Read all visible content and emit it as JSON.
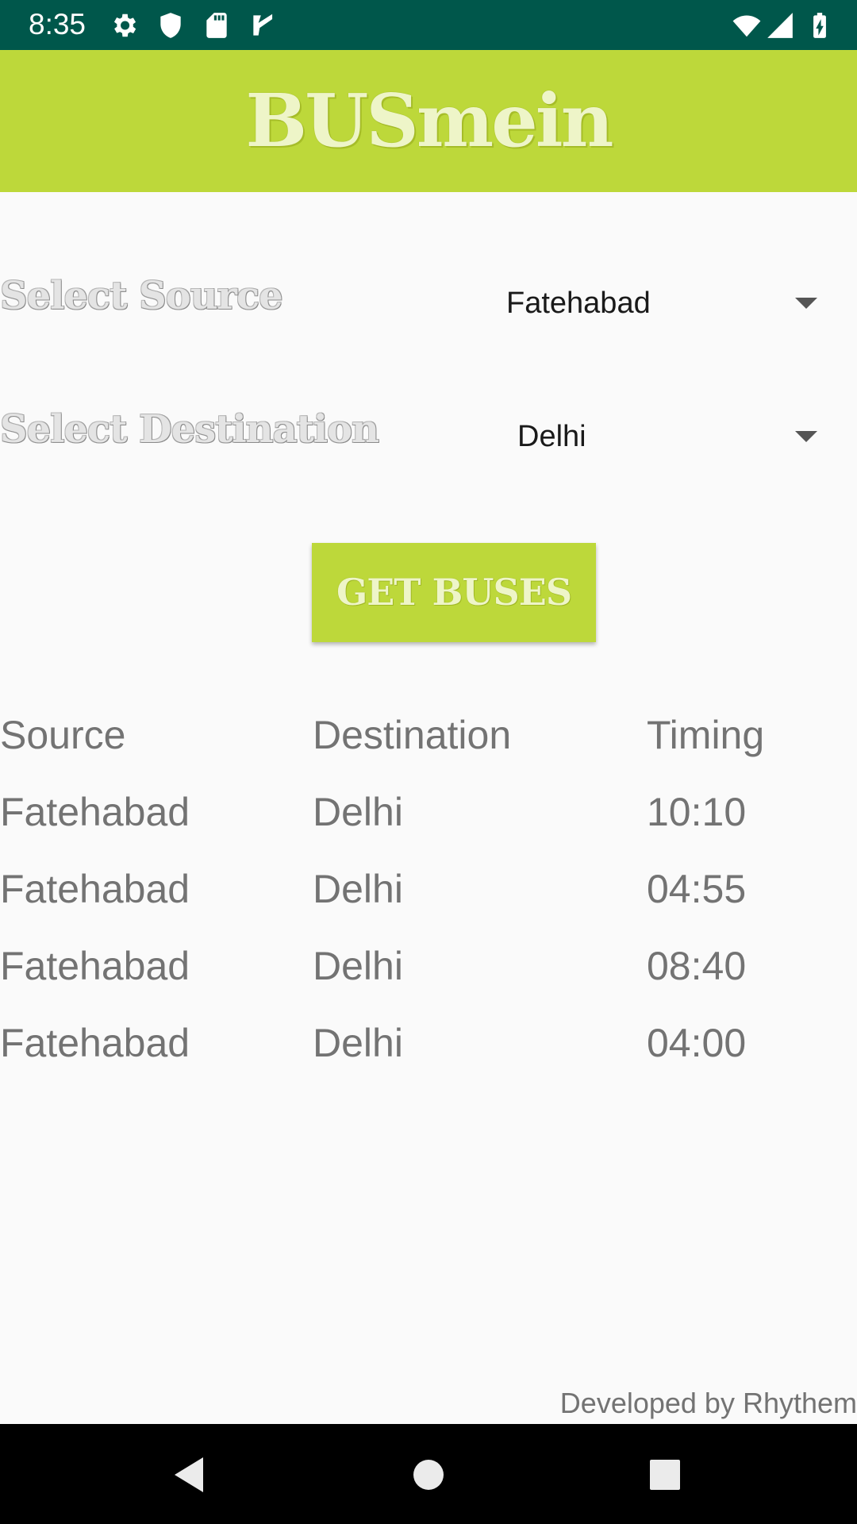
{
  "status_bar": {
    "time": "8:35",
    "left_icons": [
      "settings-icon",
      "shield-icon",
      "sd-card-icon",
      "check-icon"
    ],
    "right_icons": [
      "wifi-icon",
      "signal-icon",
      "battery-icon"
    ]
  },
  "app_bar": {
    "title": "BUSmein"
  },
  "form": {
    "source_label": "Select Source",
    "source_value": "Fatehabad",
    "destination_label": "Select Destination",
    "destination_value": "Delhi",
    "button_label": "GET BUSES"
  },
  "table": {
    "headers": [
      "Source",
      "Destination",
      "Timing"
    ],
    "rows": [
      [
        "Fatehabad",
        "Delhi",
        "10:10"
      ],
      [
        "Fatehabad",
        "Delhi",
        "04:55"
      ],
      [
        "Fatehabad",
        "Delhi",
        "08:40"
      ],
      [
        "Fatehabad",
        "Delhi",
        "04:00"
      ]
    ]
  },
  "footer": {
    "credit": "Developed by Rhythem"
  },
  "nav_bar": {
    "buttons": [
      "back-icon",
      "home-icon",
      "recents-icon"
    ]
  },
  "colors": {
    "status_bar": "#00574b",
    "accent": "#bdd83a",
    "background": "#fafafa",
    "table_text": "#737373"
  }
}
